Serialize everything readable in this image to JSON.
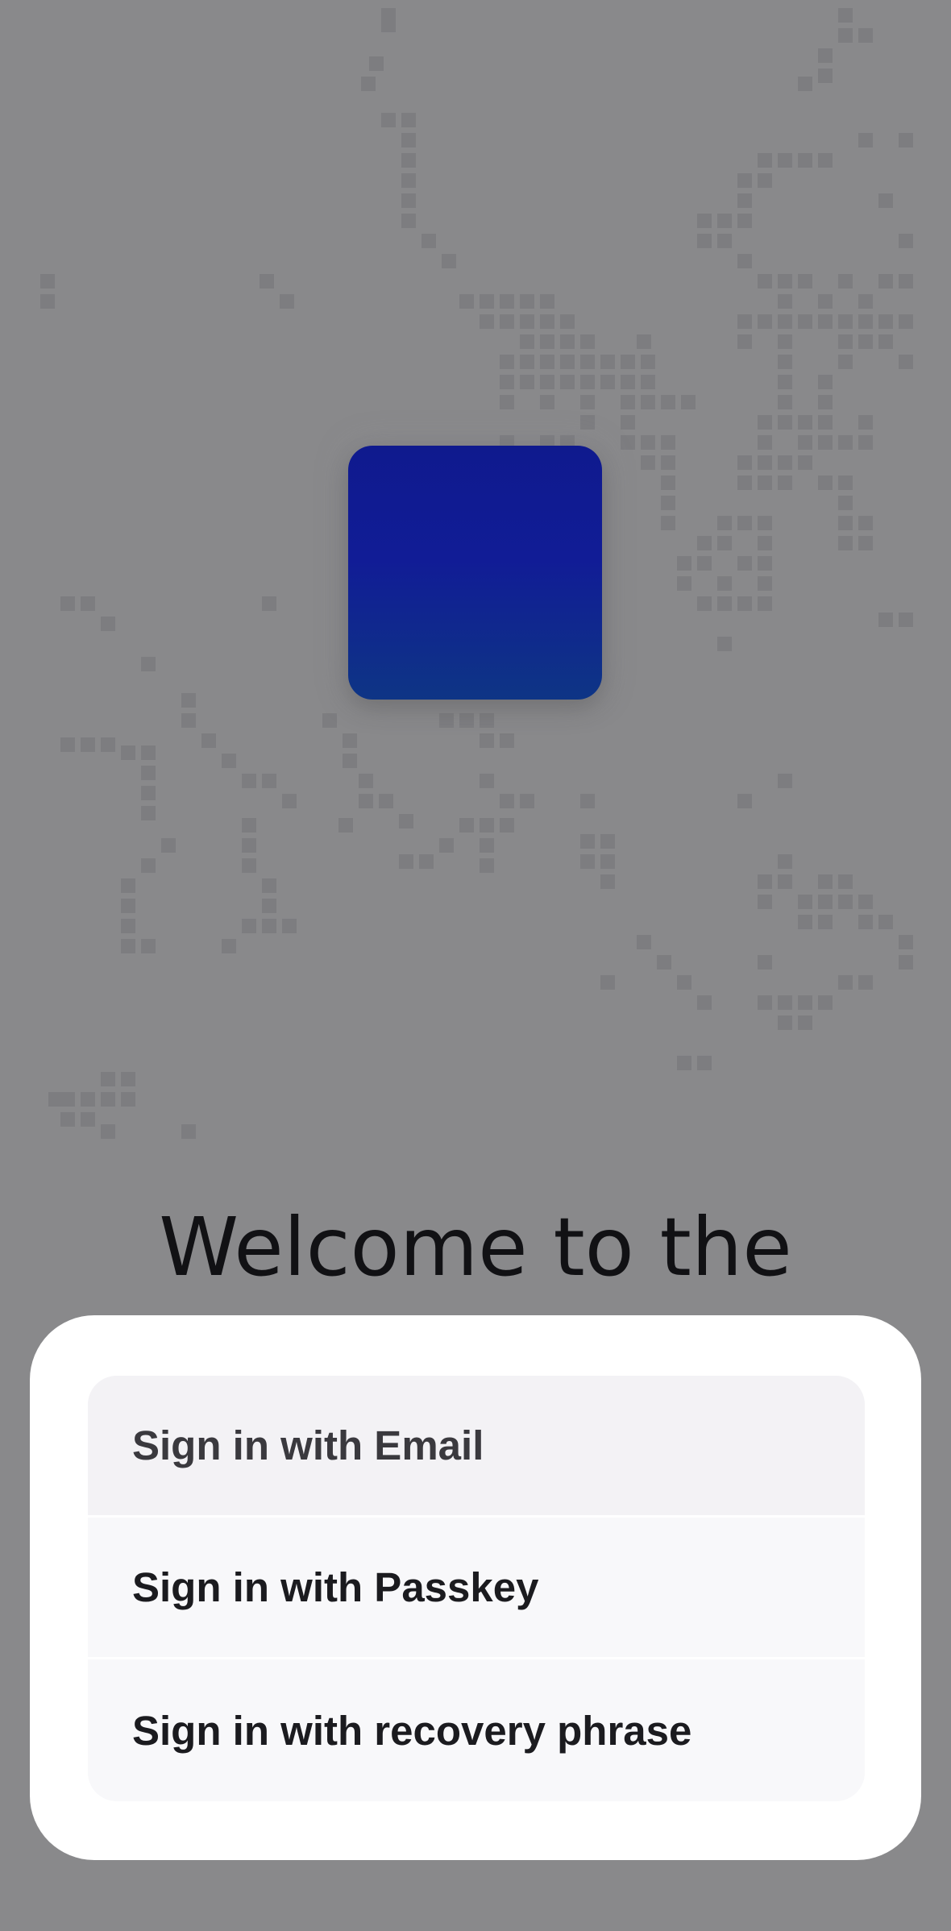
{
  "welcome": {
    "title": "Welcome to the"
  },
  "signin": {
    "options": [
      {
        "label": "Sign in with Email",
        "selected": true
      },
      {
        "label": "Sign in with Passkey",
        "selected": false
      },
      {
        "label": "Sign in with recovery phrase",
        "selected": false
      }
    ]
  },
  "colors": {
    "overlay_background": "#89898b",
    "pattern_pixels": "#7d7d80",
    "logo_gradient_top": "#0f1a8e",
    "logo_gradient_bottom": "#0e3585",
    "sheet_background": "#ffffff",
    "option_background": "#f8f8fa",
    "option_selected_background": "#f3f2f5"
  },
  "icons": {
    "logo": "app-logo-icon"
  }
}
